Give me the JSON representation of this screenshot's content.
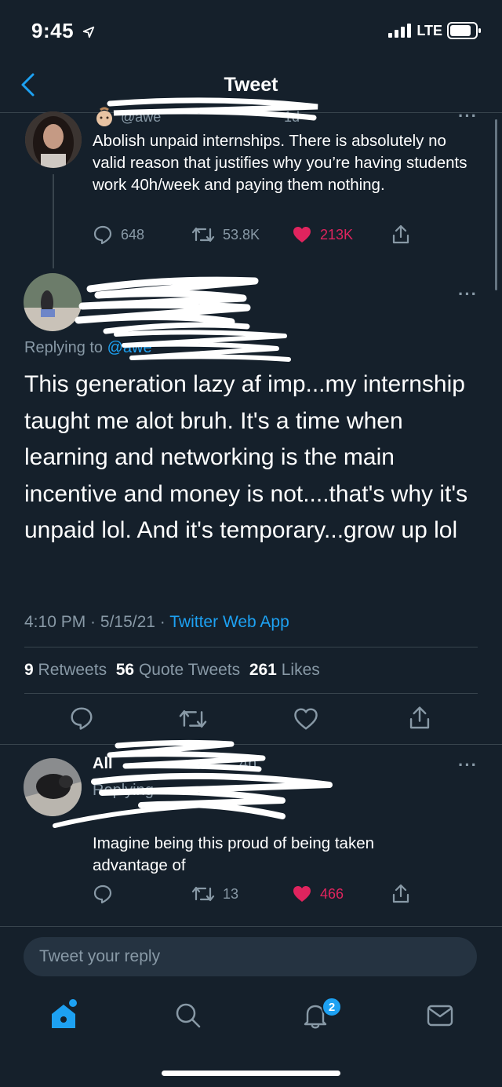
{
  "status_bar": {
    "time": "9:45",
    "network": "LTE"
  },
  "nav": {
    "title": "Tweet"
  },
  "parent_tweet": {
    "handle_visible": "@awe",
    "time_visible": "1d",
    "text": "Abolish unpaid internships. There is absolutely no valid reason that justifies why you’re having students work 40h/week and paying them nothing.",
    "replies": "648",
    "retweets": "53.8K",
    "likes": "213K"
  },
  "main_tweet": {
    "replying_to_label": "Replying to",
    "replying_to_handle": "@awe",
    "text": "This generation lazy af imp...my internship taught me alot bruh. It's a time when learning and networking is the main incentive and money is not....that's why it's unpaid lol. And it's temporary...grow up lol",
    "time": "4:10 PM",
    "date": "5/15/21",
    "source": "Twitter Web App",
    "retweets_count": "9",
    "retweets_label": "Retweets",
    "quotes_count": "56",
    "quotes_label": "Quote Tweets",
    "likes_count": "261",
    "likes_label": "Likes"
  },
  "reply_tweet": {
    "name_visible": "All",
    "time_visible": "4h",
    "replying_visible": "Replying",
    "text": "Imagine being this proud of being taken advantage of",
    "retweets": "13",
    "likes": "466"
  },
  "compose": {
    "placeholder": "Tweet your reply"
  },
  "tab_bar": {
    "notification_badge": "2"
  },
  "colors": {
    "background": "#15202b",
    "accent": "#1da1f2",
    "like": "#e0245e",
    "muted": "#8899a6"
  }
}
